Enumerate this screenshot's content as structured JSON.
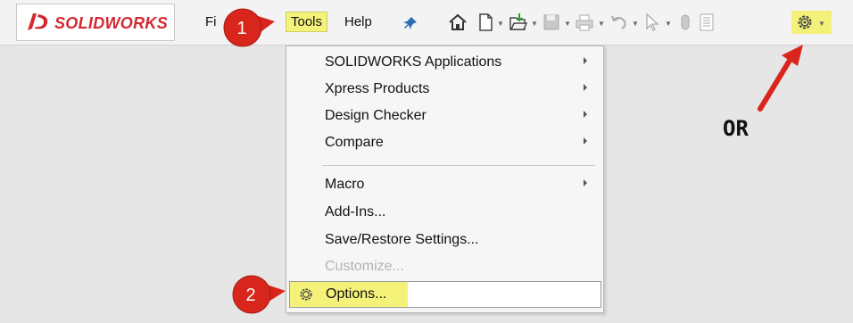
{
  "app": {
    "logo_text": "SOLIDWORKS"
  },
  "menubar": {
    "file_label": "Fi",
    "tools_label": "Tools",
    "help_label": "Help"
  },
  "toolbar": {
    "icons": [
      "home-icon",
      "new-document-icon",
      "open-icon",
      "save-icon",
      "print-icon",
      "undo-icon",
      "select-icon",
      "rebuild-icon",
      "file-properties-icon",
      "options-gear-icon"
    ]
  },
  "dropdown": {
    "items": [
      {
        "label": "SOLIDWORKS Applications",
        "submenu": true
      },
      {
        "label": "Xpress Products",
        "submenu": true
      },
      {
        "label": "Design Checker",
        "submenu": true
      },
      {
        "label": "Compare",
        "submenu": true
      },
      {
        "label": "Macro",
        "submenu": true
      },
      {
        "label": "Add-Ins...",
        "submenu": false
      },
      {
        "label": "Save/Restore Settings...",
        "submenu": false
      },
      {
        "label": "Customize...",
        "submenu": false,
        "disabled": true
      },
      {
        "label": "Options...",
        "submenu": false,
        "highlighted": true
      }
    ]
  },
  "callouts": {
    "step1": "1",
    "step2": "2",
    "or_text": "OR"
  },
  "colors": {
    "highlight": "#f5f27a",
    "callout_red": "#d9261c",
    "brand_red": "#d4282f"
  }
}
